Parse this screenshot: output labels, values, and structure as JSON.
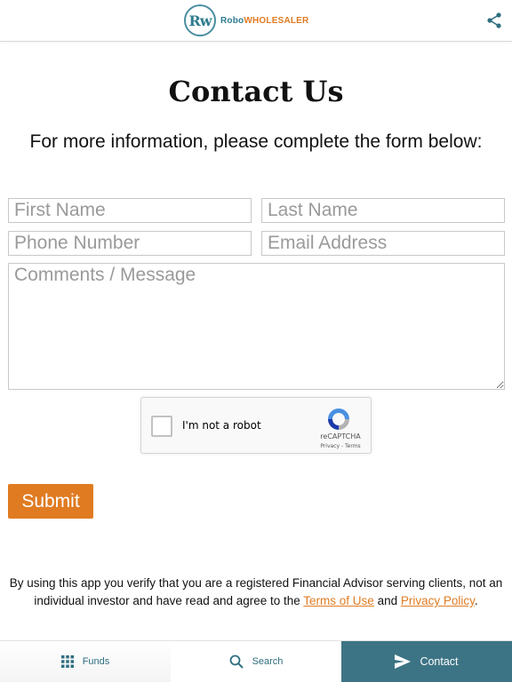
{
  "header": {
    "logo_mark": "Rw",
    "brand_robo": "Robo",
    "brand_wholesaler": "WHOLESALER",
    "share_icon": "share-icon"
  },
  "page": {
    "title": "Contact Us",
    "subtitle": "For more information, please complete the form below:"
  },
  "form": {
    "first_name_placeholder": "First Name",
    "last_name_placeholder": "Last Name",
    "phone_placeholder": "Phone Number",
    "email_placeholder": "Email Address",
    "message_placeholder": "Comments / Message",
    "first_name_value": "",
    "last_name_value": "",
    "phone_value": "",
    "email_value": "",
    "message_value": "",
    "submit_label": "Submit"
  },
  "captcha": {
    "label": "I'm not a robot",
    "brand": "reCAPTCHA",
    "links": "Privacy - Terms",
    "checked": false
  },
  "disclaimer": {
    "text_before": "By using this app you verify that you are a registered Financial Advisor serving clients, not an individual investor and have read and agree to the ",
    "terms_link": "Terms of Use",
    "text_and": " and ",
    "privacy_link": "Privacy Policy",
    "text_end": "."
  },
  "nav": {
    "items": [
      {
        "label": "Funds",
        "icon": "grid-icon",
        "active": false
      },
      {
        "label": "Search",
        "icon": "search-icon",
        "active": false
      },
      {
        "label": "Contact",
        "icon": "send-icon",
        "active": true
      }
    ]
  },
  "colors": {
    "accent_orange": "#e07b22",
    "brand_teal": "#2f7d8f",
    "nav_active": "#3d7485"
  }
}
